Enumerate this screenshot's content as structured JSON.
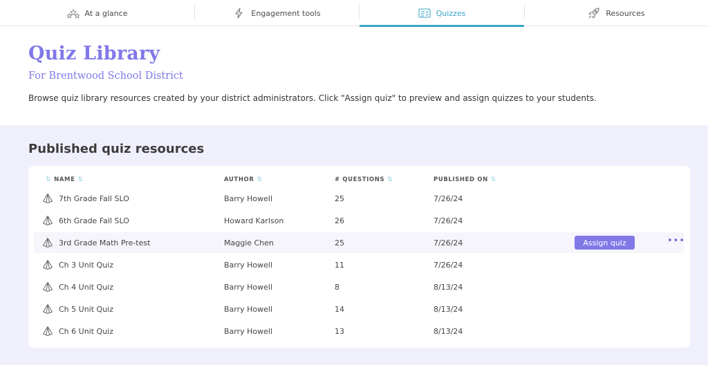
{
  "nav": {
    "tabs": [
      {
        "label": "At a glance",
        "icon": "stars-icon"
      },
      {
        "label": "Engagement tools",
        "icon": "lightning-icon"
      },
      {
        "label": "Quizzes",
        "icon": "quiz-icon"
      },
      {
        "label": "Resources",
        "icon": "rocket-icon"
      }
    ],
    "active_tab": "Quizzes"
  },
  "header": {
    "title": "Quiz Library",
    "subtitle": "For Brentwood School District",
    "description": "Browse quiz library resources created by your district administrators. Click \"Assign quiz\" to preview and assign quizzes to your students."
  },
  "section": {
    "title": "Published quiz resources"
  },
  "table": {
    "columns": {
      "name": "NAME",
      "author": "AUTHOR",
      "questions": "# QUESTIONS",
      "published": "PUBLISHED ON"
    },
    "rows": [
      {
        "name": "7th Grade Fall SLO",
        "author": "Barry Howell",
        "questions": "25",
        "published": "7/26/24"
      },
      {
        "name": "6th Grade Fall SLO",
        "author": "Howard Karlson",
        "questions": "26",
        "published": "7/26/24"
      },
      {
        "name": "3rd Grade Math Pre-test",
        "author": "Maggie Chen",
        "questions": "25",
        "published": "7/26/24"
      },
      {
        "name": "Ch 3 Unit Quiz",
        "author": "Barry Howell",
        "questions": "11",
        "published": "7/26/24"
      },
      {
        "name": "Ch 4 Unit Quiz",
        "author": "Barry Howell",
        "questions": "8",
        "published": "8/13/24"
      },
      {
        "name": "Ch 5 Unit Quiz",
        "author": "Barry Howell",
        "questions": "14",
        "published": "8/13/24"
      },
      {
        "name": "Ch 6 Unit Quiz",
        "author": "Barry Howell",
        "questions": "13",
        "published": "8/13/24"
      }
    ],
    "hovered_row_actions": {
      "assign_label": "Assign quiz",
      "more_label": "•••"
    }
  },
  "colors": {
    "accent": "#8178e8",
    "active_tab": "#3aa4c9",
    "panel_bg": "#f0f0fd"
  }
}
